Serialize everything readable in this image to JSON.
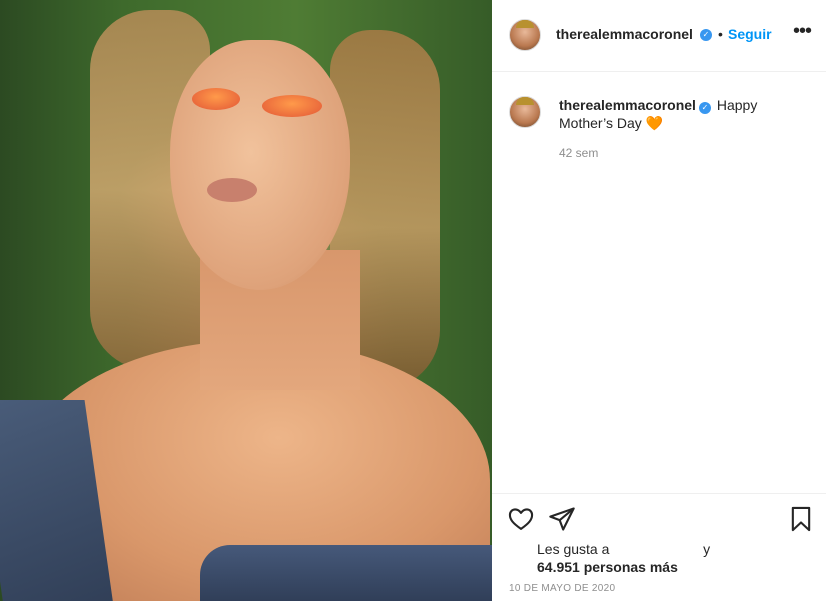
{
  "post": {
    "author": {
      "username": "therealemmacoronel",
      "verified": true,
      "verified_icon": "verified-badge-icon"
    },
    "header": {
      "separator": "•",
      "follow_label": "Seguir",
      "more_icon": "more-options-icon",
      "more_label": "•••"
    },
    "caption": {
      "username": "therealemmacoronel",
      "text": "Happy Mother’s Day 🧡",
      "time_ago": "42 sem"
    },
    "actions": {
      "like_icon": "heart-icon",
      "share_icon": "send-icon",
      "save_icon": "bookmark-icon"
    },
    "likes": {
      "prefix": "Les gusta a",
      "connector": "y",
      "count_text": "64.951 personas más"
    },
    "date": "10 DE MAYO DE 2020",
    "colors": {
      "accent": "#0095f6",
      "verified": "#3897f0",
      "text": "#262626",
      "muted": "#8e8e8e",
      "border": "#efefef"
    }
  }
}
